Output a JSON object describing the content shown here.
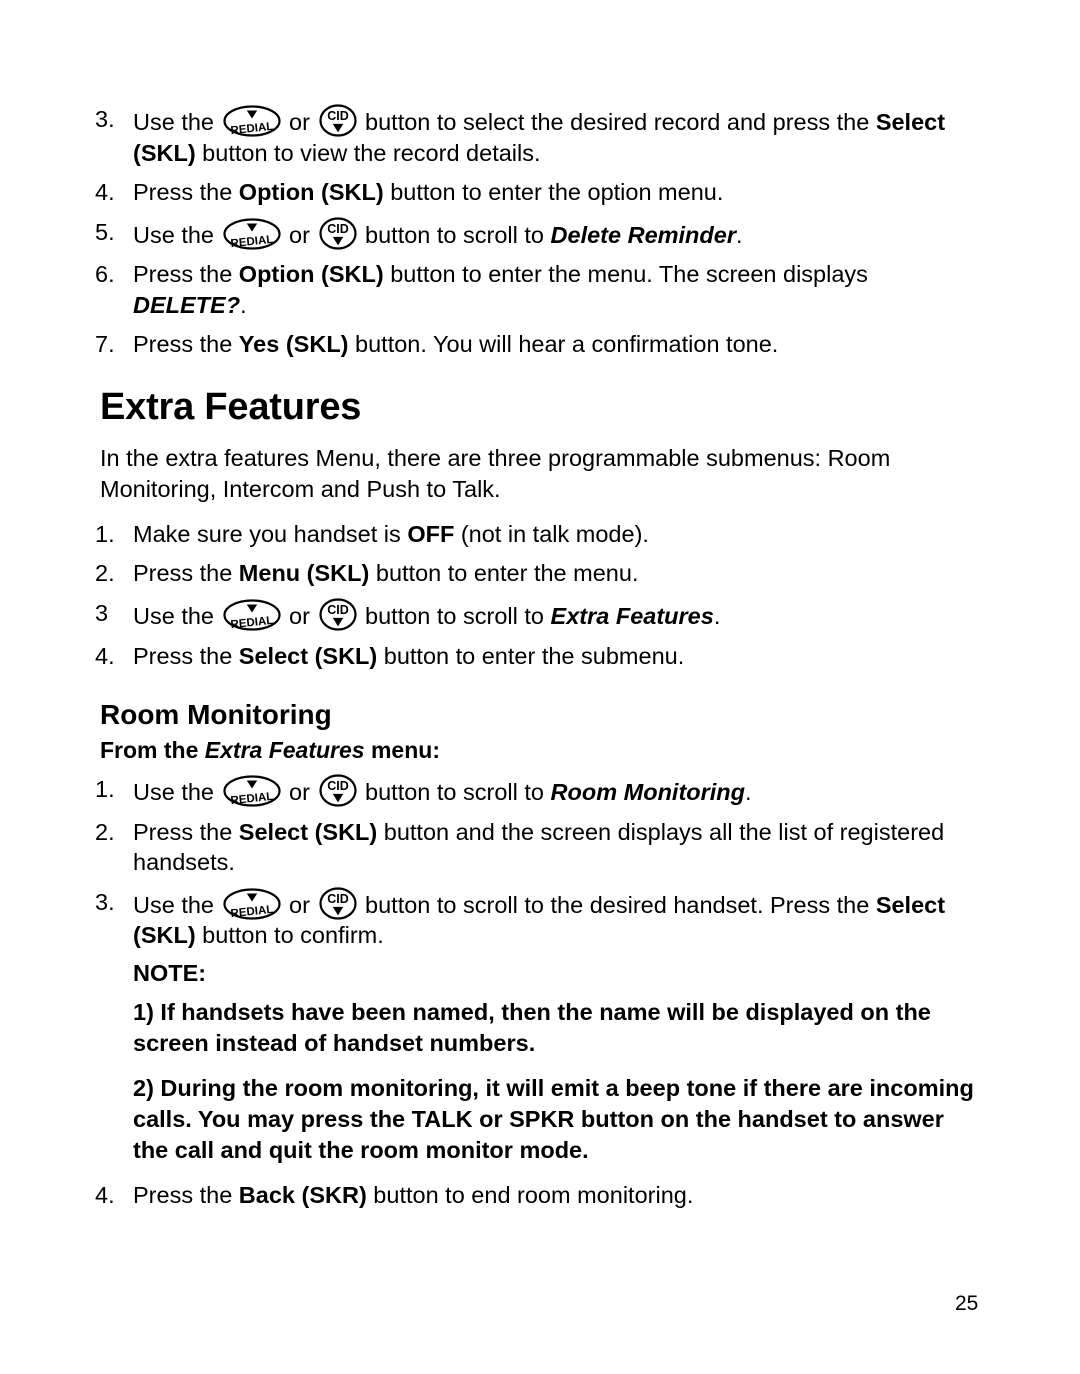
{
  "page": {
    "number": "25",
    "title": "Extra Features",
    "subtitle": "Room Monitoring"
  },
  "top_steps": [
    {
      "num": "3.",
      "parts": [
        {
          "t": "text",
          "v": "Use the "
        },
        {
          "t": "icon",
          "v": "redial-button-icon"
        },
        {
          "t": "text",
          "v": " or "
        },
        {
          "t": "icon",
          "v": "cid-button-icon"
        },
        {
          "t": "text",
          "v": " button to select the desired record and press the "
        },
        {
          "t": "bold",
          "v": "Select (SKL)"
        },
        {
          "t": "text",
          "v": " button to view the record details."
        }
      ]
    },
    {
      "num": "4.",
      "parts": [
        {
          "t": "text",
          "v": "Press the "
        },
        {
          "t": "bold",
          "v": "Option (SKL)"
        },
        {
          "t": "text",
          "v": " button to enter the option menu."
        }
      ]
    },
    {
      "num": "5.",
      "parts": [
        {
          "t": "text",
          "v": "Use the "
        },
        {
          "t": "icon",
          "v": "redial-button-icon"
        },
        {
          "t": "text",
          "v": " or "
        },
        {
          "t": "icon",
          "v": "cid-button-icon"
        },
        {
          "t": "text",
          "v": " button to scroll to "
        },
        {
          "t": "bolditalic",
          "v": "Delete Reminder"
        },
        {
          "t": "text",
          "v": "."
        }
      ]
    },
    {
      "num": "6.",
      "parts": [
        {
          "t": "text",
          "v": "Press the "
        },
        {
          "t": "bold",
          "v": "Option (SKL)"
        },
        {
          "t": "text",
          "v": " button to enter the menu. The screen displays "
        },
        {
          "t": "bolditalic",
          "v": "DELETE?"
        },
        {
          "t": "text",
          "v": "."
        }
      ]
    },
    {
      "num": "7.",
      "parts": [
        {
          "t": "text",
          "v": "Press the "
        },
        {
          "t": "bold",
          "v": "Yes (SKL)"
        },
        {
          "t": "text",
          "v": " button. You will hear a confirmation tone."
        }
      ]
    }
  ],
  "intro_paragraph": "In the extra features Menu, there are three programmable submenus: Room Monitoring, Intercom and Push to Talk.",
  "extra_steps": [
    {
      "num": "1.",
      "parts": [
        {
          "t": "text",
          "v": "Make sure you handset is "
        },
        {
          "t": "bold",
          "v": "OFF"
        },
        {
          "t": "text",
          "v": " (not in talk mode)."
        }
      ]
    },
    {
      "num": "2.",
      "parts": [
        {
          "t": "text",
          "v": "Press the "
        },
        {
          "t": "bold",
          "v": "Menu (SKL)"
        },
        {
          "t": "text",
          "v": " button to enter the menu."
        }
      ]
    },
    {
      "num": "3",
      "parts": [
        {
          "t": "text",
          "v": "Use the "
        },
        {
          "t": "icon",
          "v": "redial-button-icon"
        },
        {
          "t": "text",
          "v": " or "
        },
        {
          "t": "icon",
          "v": "cid-button-icon"
        },
        {
          "t": "text",
          "v": " button to scroll to "
        },
        {
          "t": "bolditalic",
          "v": "Extra Features"
        },
        {
          "t": "text",
          "v": "."
        }
      ]
    },
    {
      "num": "4.",
      "parts": [
        {
          "t": "text",
          "v": "Press the "
        },
        {
          "t": "bold",
          "v": "Select (SKL)"
        },
        {
          "t": "text",
          "v": " button to enter the submenu."
        }
      ]
    }
  ],
  "from_line": [
    {
      "t": "bold",
      "v": "From the "
    },
    {
      "t": "bolditalic",
      "v": "Extra Features"
    },
    {
      "t": "bold",
      "v": " menu:"
    }
  ],
  "room_steps": [
    {
      "num": "1.",
      "parts": [
        {
          "t": "text",
          "v": "Use the "
        },
        {
          "t": "icon",
          "v": "redial-button-icon"
        },
        {
          "t": "text",
          "v": " or "
        },
        {
          "t": "icon",
          "v": "cid-button-icon"
        },
        {
          "t": "text",
          "v": " button to scroll to "
        },
        {
          "t": "bolditalic",
          "v": "Room Monitoring"
        },
        {
          "t": "text",
          "v": "."
        }
      ]
    },
    {
      "num": "2.",
      "parts": [
        {
          "t": "text",
          "v": "Press the "
        },
        {
          "t": "bold",
          "v": "Select (SKL)"
        },
        {
          "t": "text",
          "v": " button and the screen displays all the list of registered handsets."
        }
      ]
    },
    {
      "num": "3.",
      "parts": [
        {
          "t": "text",
          "v": "Use the "
        },
        {
          "t": "icon",
          "v": "redial-button-icon"
        },
        {
          "t": "text",
          "v": " or "
        },
        {
          "t": "icon",
          "v": "cid-button-icon"
        },
        {
          "t": "text",
          "v": " button to scroll to the desired handset. Press the "
        },
        {
          "t": "bold",
          "v": "Select (SKL)"
        },
        {
          "t": "text",
          "v": " button to confirm."
        }
      ]
    }
  ],
  "note": {
    "label": "NOTE:",
    "items": [
      "1) If handsets have been named, then the name will be displayed on the screen instead of handset numbers.",
      "2) During the room monitoring, it will emit a beep tone if there are incoming calls. You may press the TALK or SPKR button on the handset to answer the call and quit the room monitor mode."
    ]
  },
  "final_step": {
    "num": "4.",
    "parts": [
      {
        "t": "text",
        "v": "Press the "
      },
      {
        "t": "bold",
        "v": "Back (SKR)"
      },
      {
        "t": "text",
        "v": " button to end room monitoring."
      }
    ]
  },
  "icons": {
    "redial_label": "REDIAL",
    "cid_label": "CID"
  }
}
